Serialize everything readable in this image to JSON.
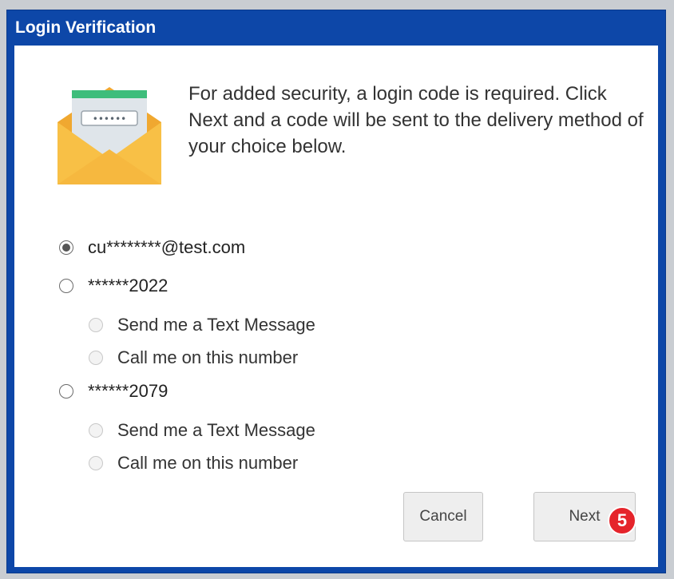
{
  "dialog": {
    "title": "Login Verification",
    "intro": "For added security, a login code is required. Click Next and a code will be sent to the delivery method of your choice below.",
    "code_mask": "••••••"
  },
  "options": {
    "email": {
      "label": "cu********@test.com",
      "selected": true
    },
    "phone1": {
      "label": "******2022",
      "selected": false,
      "text": "Send me a Text Message",
      "call": "Call me on this number"
    },
    "phone2": {
      "label": "******2079",
      "selected": false,
      "text": "Send me a Text Message",
      "call": "Call me on this number"
    }
  },
  "buttons": {
    "cancel": "Cancel",
    "next": "Next"
  },
  "step_badge": "5",
  "colors": {
    "titlebar": "#0d47a8",
    "envelope": "#f6b83f",
    "letter": "#dfe5ea",
    "letter_band": "#3ebd7b",
    "badge": "#e5242b"
  },
  "icons": {
    "illustration": "email-envelope-icon"
  }
}
